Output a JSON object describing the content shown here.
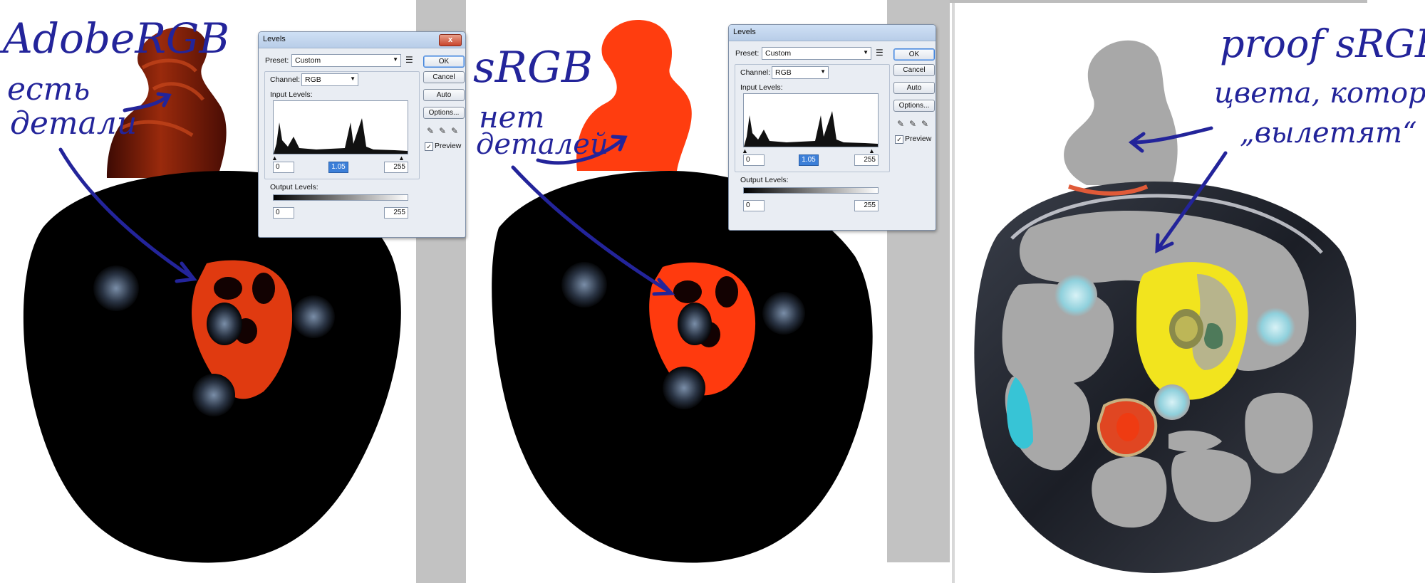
{
  "annotations": {
    "p1_title": "AdobeRGB",
    "p1_line1": "есть",
    "p1_line2": "детали",
    "p2_title": "sRGB",
    "p2_line1": "нет",
    "p2_line2": "деталей",
    "p3_title": "proof sRGB",
    "p3_line1": "цвета, которые",
    "p3_line2": "„вылетят“"
  },
  "dialog": {
    "title": "Levels",
    "close": "x",
    "preset_label": "Preset:",
    "preset_value": "Custom",
    "channel_label": "Channel:",
    "channel_value": "RGB",
    "input_levels_label": "Input Levels:",
    "input_black": "0",
    "input_gamma": "1.05",
    "input_white": "255",
    "output_levels_label": "Output Levels:",
    "output_black": "0",
    "output_white": "255",
    "ok": "OK",
    "cancel": "Cancel",
    "auto": "Auto",
    "options": "Options...",
    "preview_label": "Preview",
    "preview_checked": "✓",
    "preset_menu_icon": "menu-lines-icon",
    "eyedropper_icons": [
      "eyedropper-black-icon",
      "eyedropper-gray-icon",
      "eyedropper-white-icon"
    ]
  },
  "colors": {
    "annotation_ink": "#23249a",
    "adobe_red": "#7a1a07",
    "srgb_orange": "#ff3d0f",
    "proof_gray": "#a8a8a8",
    "ok_highlight": "#3c7fd8"
  }
}
